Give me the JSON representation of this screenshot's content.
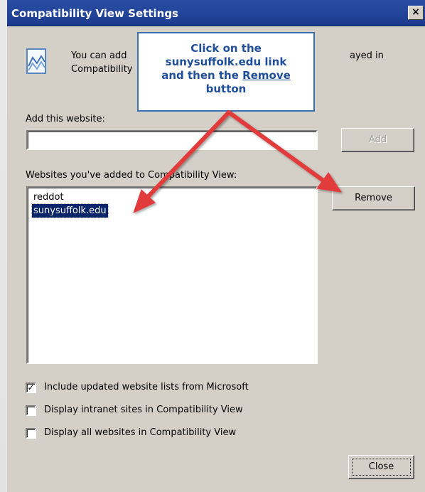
{
  "window": {
    "title": "Compatibility View Settings",
    "close_glyph": "×"
  },
  "description": {
    "line1_start": "You can add",
    "line1_end": "ayed in",
    "line2_start": "Compatibility"
  },
  "callout": {
    "line1": "Click on the",
    "line2": "sunysuffolk.edu link",
    "line3_prefix": "and then the",
    "line3_link": "Remove",
    "line4": "button"
  },
  "add_section": {
    "label": "Add this website:",
    "input_value": "",
    "add_button": "Add"
  },
  "list_section": {
    "label": "Websites you've added to Compatibility View:",
    "items": [
      {
        "label": "reddot",
        "selected": false
      },
      {
        "label": "sunysuffolk.edu",
        "selected": true
      }
    ],
    "remove_button": "Remove"
  },
  "options": [
    {
      "label": "Include updated website lists from Microsoft",
      "checked": true,
      "mark": "✓"
    },
    {
      "label": "Display intranet sites in Compatibility View",
      "checked": false,
      "mark": ""
    },
    {
      "label": "Display all websites in Compatibility View",
      "checked": false,
      "mark": ""
    }
  ],
  "footer": {
    "close_button": "Close"
  },
  "colors": {
    "titlebar": "#1c3b8f",
    "selection": "#0a246a",
    "callout_text": "#1f4e9a",
    "arrow": "#e23b3b"
  }
}
